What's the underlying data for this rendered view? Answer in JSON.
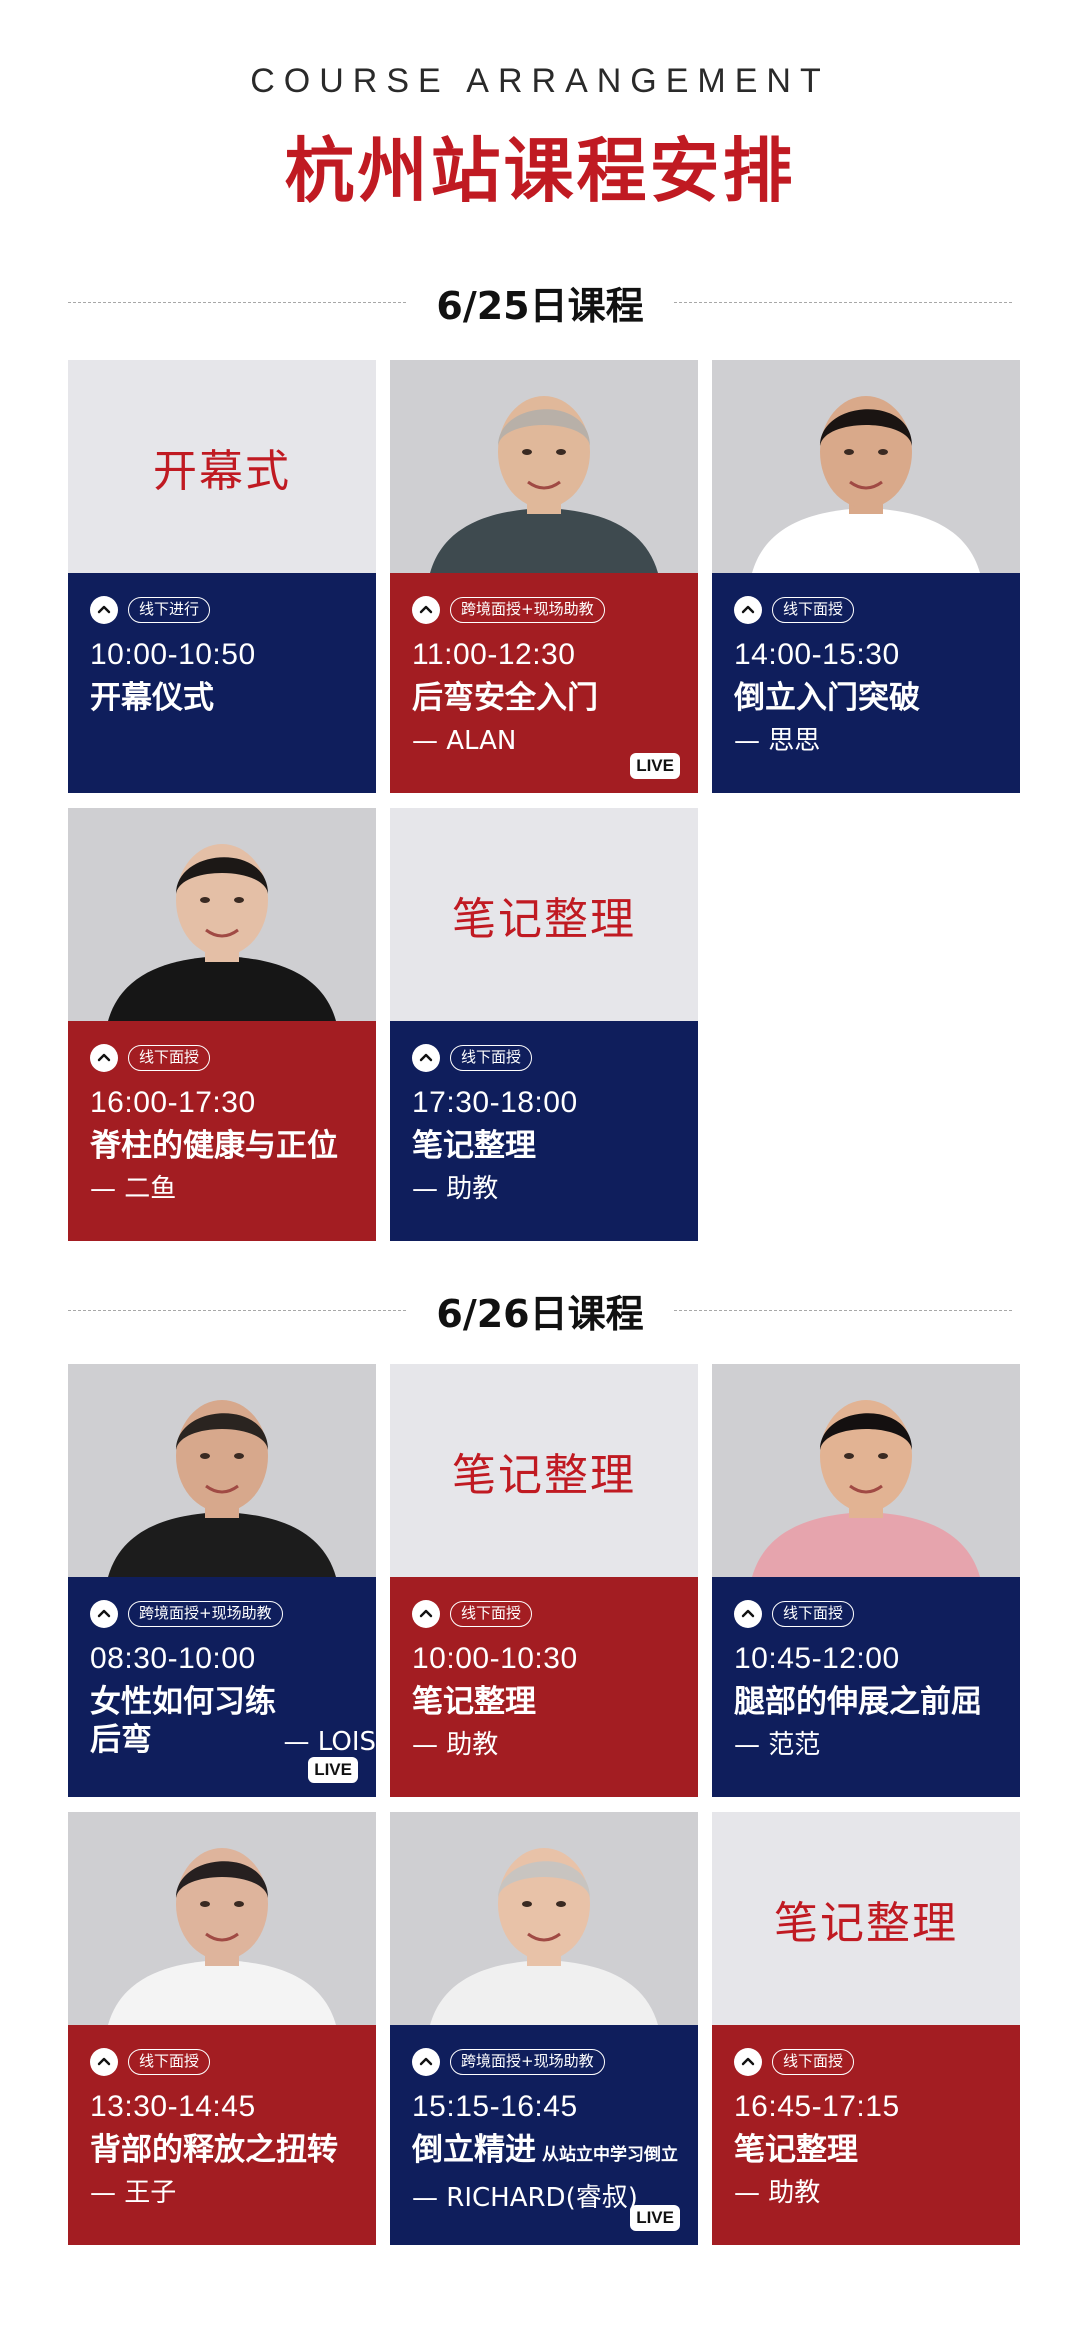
{
  "header": {
    "subtitle": "COURSE ARRANGEMENT",
    "title": "杭州站课程安排"
  },
  "colors": {
    "navy": "#0f1e5c",
    "red": "#a31d22",
    "accent_text": "#c01a22",
    "panel_bg": "#e6e6ea"
  },
  "days": [
    {
      "label": "6/25日课程",
      "cards": [
        {
          "top_text": "开幕式",
          "tag": "线下进行",
          "time": "10:00-10:50",
          "course": "开幕仪式",
          "teacher": "",
          "live": false,
          "color": "navy"
        },
        {
          "photo": "instructor-photo",
          "tag": "跨境面授+现场助教",
          "time": "11:00-12:30",
          "course": "后弯安全入门",
          "teacher": "— ALAN",
          "live": true,
          "live_label": "LIVE",
          "color": "red"
        },
        {
          "photo": "instructor-photo",
          "tag": "线下面授",
          "time": "14:00-15:30",
          "course": "倒立入门突破",
          "teacher": "— 思思",
          "live": false,
          "color": "navy"
        },
        {
          "photo": "instructor-photo",
          "tag": "线下面授",
          "time": "16:00-17:30",
          "course": "脊柱的健康与正位",
          "teacher": "— 二鱼",
          "live": false,
          "color": "red"
        },
        {
          "top_text": "笔记整理",
          "tag": "线下面授",
          "time": "17:30-18:00",
          "course": "笔记整理",
          "teacher": "— 助教",
          "live": false,
          "color": "navy"
        }
      ]
    },
    {
      "label": "6/26日课程",
      "cards": [
        {
          "photo": "instructor-photo",
          "tag": "跨境面授+现场助教",
          "time": "08:30-10:00",
          "course": "女性如何习练后弯",
          "teacher": "— LOIS",
          "live": true,
          "live_label": "LIVE",
          "color": "navy"
        },
        {
          "top_text": "笔记整理",
          "tag": "线下面授",
          "time": "10:00-10:30",
          "course": "笔记整理",
          "teacher": "— 助教",
          "live": false,
          "color": "red"
        },
        {
          "photo": "instructor-photo",
          "tag": "线下面授",
          "time": "10:45-12:00",
          "course": "腿部的伸展之前屈",
          "teacher": "— 范范",
          "live": false,
          "color": "navy"
        },
        {
          "photo": "instructor-photo",
          "tag": "线下面授",
          "time": "13:30-14:45",
          "course": "背部的释放之扭转",
          "teacher": "— 王子",
          "live": false,
          "color": "red"
        },
        {
          "photo": "instructor-photo",
          "tag": "跨境面授+现场助教",
          "time": "15:15-16:45",
          "course": "倒立精进",
          "course_note": "从站立中学习倒立",
          "teacher": "— RICHARD(睿叔)",
          "live": true,
          "live_label": "LIVE",
          "color": "navy"
        },
        {
          "top_text": "笔记整理",
          "tag": "线下面授",
          "time": "16:45-17:15",
          "course": "笔记整理",
          "teacher": "— 助教",
          "live": false,
          "color": "red"
        }
      ]
    }
  ]
}
